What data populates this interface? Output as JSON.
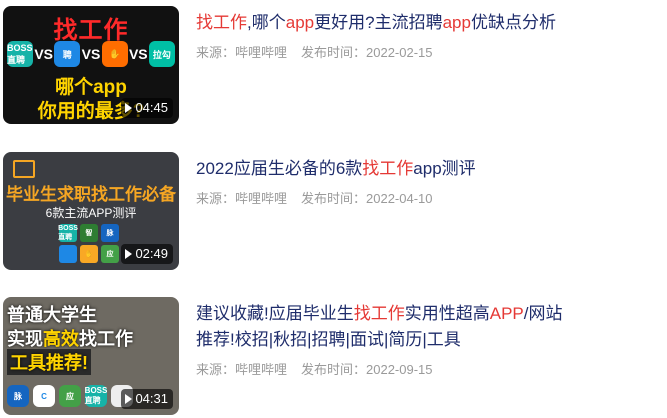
{
  "items": [
    {
      "title_parts": [
        "找工作",
        ",哪个",
        "app",
        "更好用?主流招聘",
        "app",
        "优缺点分析"
      ],
      "source": "来源：哔哩哔哩",
      "date": "发布时间：2022-02-15",
      "duration": "04:45",
      "thumb_text": {
        "top": "找工作",
        "vs": "VS",
        "mid": "哪个app",
        "bot": "你用的最多?"
      },
      "thumb_icons": [
        "BOSS直聘",
        "聘",
        "✋",
        "拉勾"
      ]
    },
    {
      "title_parts": [
        "2022应届生必备的6款",
        "找工作",
        "app测评"
      ],
      "source": "来源：哔哩哔哩",
      "date": "发布时间：2022-04-10",
      "duration": "02:49",
      "thumb_text": {
        "line1": "毕业生求职找工作必备",
        "line2": "6款主流APP测评"
      },
      "thumb_icons": [
        "BOSS直聘",
        "智",
        "脉",
        "",
        "✋",
        "应"
      ]
    },
    {
      "title_parts": [
        "建议收藏!应届毕业生",
        "找工作",
        "实用性超高",
        "APP",
        "/网站推荐!校招|秋招|招聘|面试|简历|工具"
      ],
      "source": "来源：哔哩哔哩",
      "date": "发布时间：2022-09-15",
      "duration": "04:31",
      "thumb_text": {
        "l1": "普通大学生",
        "l2a": "实现",
        "l2b": "高效",
        "l2c": "找工作",
        "l3": "工具推荐!"
      },
      "thumb_icons": [
        "脉",
        "C",
        "应",
        "BOSS直聘",
        ""
      ]
    }
  ],
  "colors": {
    "title": "#1f2d6b",
    "highlight": "#e53935",
    "meta": "#9a9a9a"
  }
}
